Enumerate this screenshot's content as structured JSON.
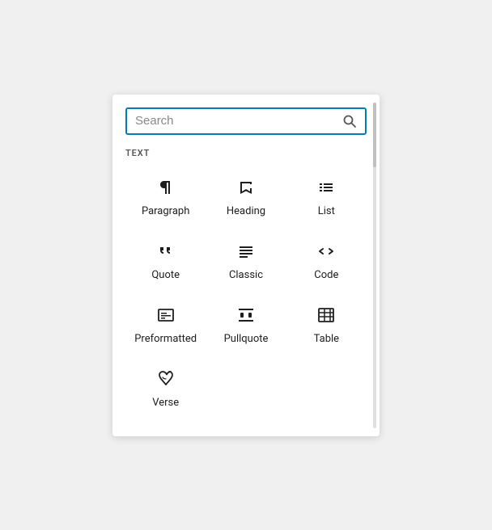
{
  "search": {
    "placeholder": "Search",
    "value": ""
  },
  "section": {
    "label": "TEXT"
  },
  "blocks": [
    {
      "id": "paragraph",
      "label": "Paragraph",
      "icon": "paragraph"
    },
    {
      "id": "heading",
      "label": "Heading",
      "icon": "heading"
    },
    {
      "id": "list",
      "label": "List",
      "icon": "list"
    },
    {
      "id": "quote",
      "label": "Quote",
      "icon": "quote"
    },
    {
      "id": "classic",
      "label": "Classic",
      "icon": "classic"
    },
    {
      "id": "code",
      "label": "Code",
      "icon": "code"
    },
    {
      "id": "preformatted",
      "label": "Preformatted",
      "icon": "preformatted"
    },
    {
      "id": "pullquote",
      "label": "Pullquote",
      "icon": "pullquote"
    },
    {
      "id": "table",
      "label": "Table",
      "icon": "table"
    },
    {
      "id": "verse",
      "label": "Verse",
      "icon": "verse"
    }
  ]
}
